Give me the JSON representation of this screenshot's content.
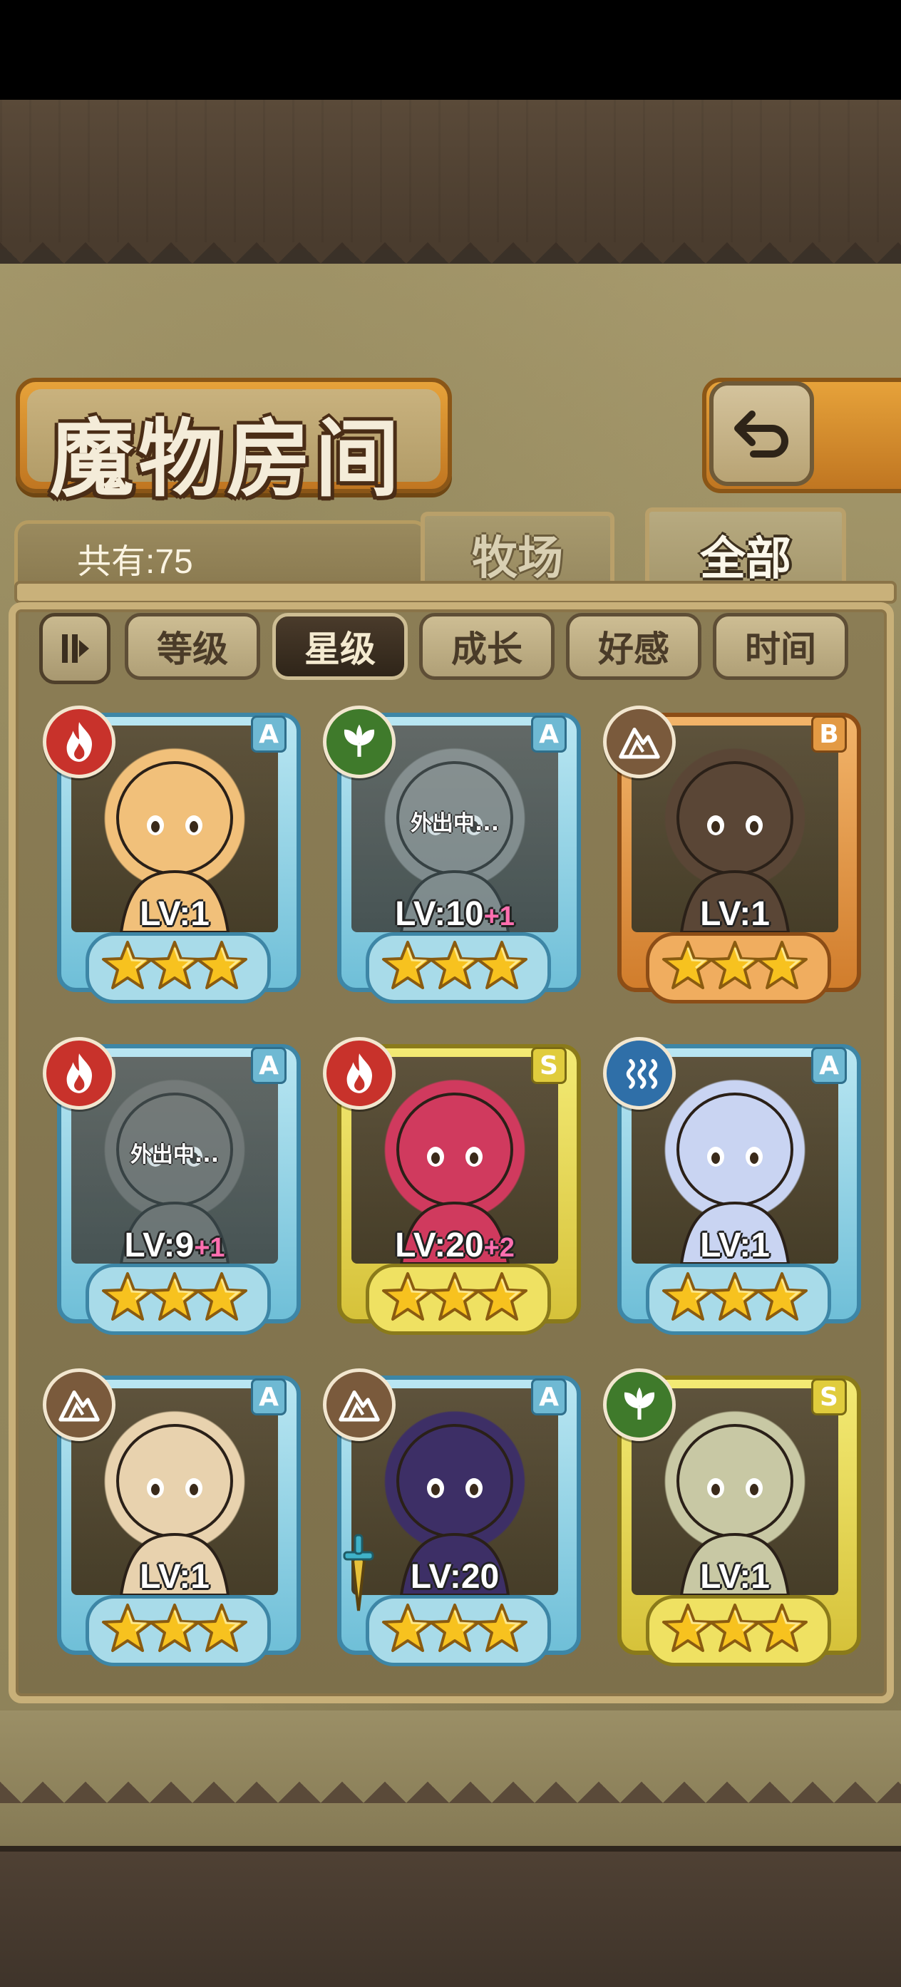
{
  "header": {
    "title": "魔物房间"
  },
  "summary": {
    "count_label": "共有:75"
  },
  "tabs": [
    {
      "label": "牧场",
      "active": false
    },
    {
      "label": "全部",
      "active": true
    }
  ],
  "sort": {
    "toggle_icon": "sort-order-icon",
    "options": [
      {
        "label": "等级",
        "active": false
      },
      {
        "label": "星级",
        "active": true
      },
      {
        "label": "成长",
        "active": false
      },
      {
        "label": "好感",
        "active": false
      },
      {
        "label": "时间",
        "active": false
      }
    ]
  },
  "monsters": [
    {
      "grade": "A",
      "element": "fire",
      "level": "LV:1",
      "bonus": "",
      "stars": 3,
      "away": "",
      "frame": "blue",
      "portrait": "#f1c07a"
    },
    {
      "grade": "A",
      "element": "leaf",
      "level": "LV:10",
      "bonus": "+1",
      "stars": 3,
      "away": "外出中...",
      "frame": "blue",
      "portrait": "#8d8a80"
    },
    {
      "grade": "B",
      "element": "earth",
      "level": "LV:1",
      "bonus": "",
      "stars": 3,
      "away": "",
      "frame": "orange",
      "portrait": "#5a4636"
    },
    {
      "grade": "A",
      "element": "fire",
      "level": "LV:9",
      "bonus": "+1",
      "stars": 3,
      "away": "外出中...",
      "frame": "blue",
      "portrait": "#7d6a57"
    },
    {
      "grade": "S",
      "element": "fire",
      "level": "LV:20",
      "bonus": "+2",
      "stars": 3,
      "away": "",
      "frame": "yellow",
      "portrait": "#d03a5e"
    },
    {
      "grade": "A",
      "element": "water",
      "level": "LV:1",
      "bonus": "",
      "stars": 3,
      "away": "",
      "frame": "blue",
      "portrait": "#c9d4f2"
    },
    {
      "grade": "A",
      "element": "earth",
      "level": "LV:1",
      "bonus": "",
      "stars": 3,
      "away": "",
      "frame": "blue",
      "portrait": "#e8d2ae"
    },
    {
      "grade": "A",
      "element": "earth",
      "level": "LV:20",
      "bonus": "",
      "stars": 3,
      "away": "",
      "frame": "blue",
      "portrait": "#3d2f66",
      "equip": "sword-icon"
    },
    {
      "grade": "S",
      "element": "leaf",
      "level": "LV:1",
      "bonus": "",
      "stars": 3,
      "away": "",
      "frame": "yellow",
      "portrait": "#c8c8a4"
    }
  ],
  "colors": {
    "fire": "#c8322b",
    "leaf": "#3f7a2b",
    "earth": "#7a5a3c",
    "water": "#2f6fa8",
    "star": "#f7c21f"
  }
}
